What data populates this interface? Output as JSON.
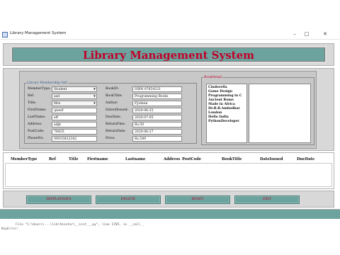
{
  "window": {
    "title": "Library Management System"
  },
  "header": {
    "title": "Library Management System"
  },
  "member_frame": {
    "legend": "Library Membership Info",
    "left_fields": [
      {
        "label": "MemberType:",
        "value": "Student",
        "kind": "combo"
      },
      {
        "label": "Ref:",
        "value": "asd",
        "kind": "combo"
      },
      {
        "label": "Title:",
        "value": "Mrs",
        "kind": "combo"
      },
      {
        "label": "FirstName:",
        "value": "qwerf",
        "kind": "field"
      },
      {
        "label": "LastName:",
        "value": "eff",
        "kind": "field"
      },
      {
        "label": "Address:",
        "value": "adjk",
        "kind": "field"
      },
      {
        "label": "PostCode:",
        "value": "78435",
        "kind": "field"
      },
      {
        "label": "PhoneNo:",
        "value": "09035832342",
        "kind": "field"
      }
    ],
    "right_fields": [
      {
        "label": "BookID:",
        "value": "ISBN 87654321"
      },
      {
        "label": "BookTitle:",
        "value": "Programming Books"
      },
      {
        "label": "Author:",
        "value": "P.Johnin"
      },
      {
        "label": "DateofIssued:",
        "value": "2020-06-25"
      },
      {
        "label": "DueDate:",
        "value": "2020-07-05"
      },
      {
        "label": "ReturnFine:",
        "value": "Rs.50"
      },
      {
        "label": "ReturnDate:",
        "value": "2020-06-27"
      },
      {
        "label": "Price:",
        "value": "Rs.549"
      }
    ]
  },
  "book_detail": {
    "legend": "BookDetail",
    "books": [
      "Cinderella",
      "Game Design",
      "Programming in C",
      "Ancient Rome",
      "Made in Africa",
      "Dr.B.R.Ambedkar",
      "London",
      "Hello India",
      "PythonDeveloper"
    ]
  },
  "table": {
    "headers": [
      "MemberType",
      "Ref",
      "Title",
      "Firstname",
      "Lastname",
      "Address",
      "PostCode",
      "BookTitle",
      "DateIssued",
      "DueDate"
    ]
  },
  "buttons": {
    "add": "DISPLAYDATA",
    "delete": "DELETE",
    "reset": "RESET",
    "exit": "EXIT"
  },
  "console": {
    "line1": "File \"C:\\Users\\...\\lib\\tkinter\\__init__.py\", line 1705, in __call__",
    "line2": "KeyError:"
  },
  "colors": {
    "accent": "#6da39e",
    "title_red": "#c00028",
    "panel": "#d8d8d8"
  }
}
